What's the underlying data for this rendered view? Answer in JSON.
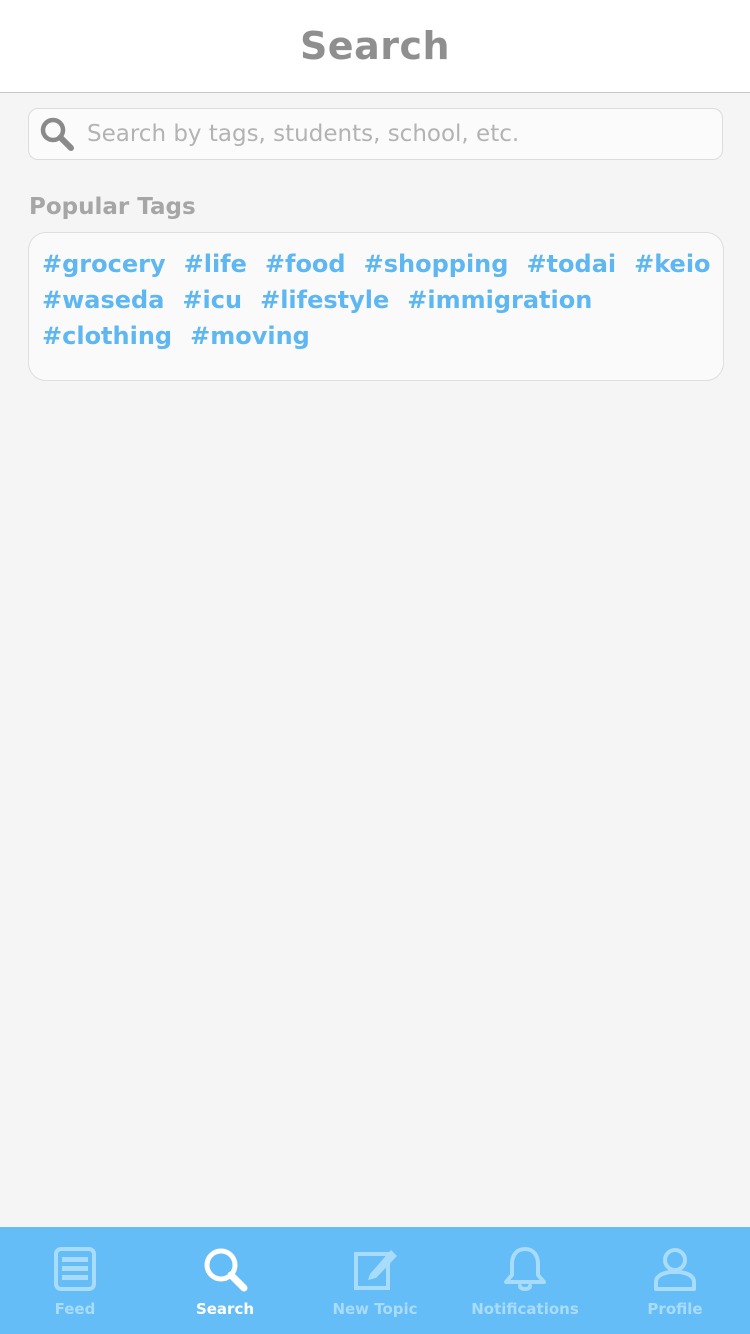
{
  "header": {
    "title": "Search"
  },
  "search": {
    "placeholder": "Search by tags, students, school, etc.",
    "value": ""
  },
  "popular": {
    "title": "Popular Tags",
    "tags": [
      "#grocery",
      "#life",
      "#food",
      "#shopping",
      "#todai",
      "#keio",
      "#waseda",
      "#icu",
      "#lifestyle",
      "#immigration",
      "#clothing",
      "#moving"
    ]
  },
  "tabbar": {
    "active": "search",
    "tabs": [
      {
        "id": "feed",
        "label": "Feed",
        "icon": "feed-icon"
      },
      {
        "id": "search",
        "label": "Search",
        "icon": "search-icon"
      },
      {
        "id": "new-topic",
        "label": "New Topic",
        "icon": "compose-icon"
      },
      {
        "id": "notifications",
        "label": "Notifications",
        "icon": "bell-icon"
      },
      {
        "id": "profile",
        "label": "Profile",
        "icon": "user-icon"
      }
    ]
  },
  "colors": {
    "accent": "#5fb7f2",
    "tabbar": "#64bdf7",
    "title_gray": "#8f8f8f"
  }
}
